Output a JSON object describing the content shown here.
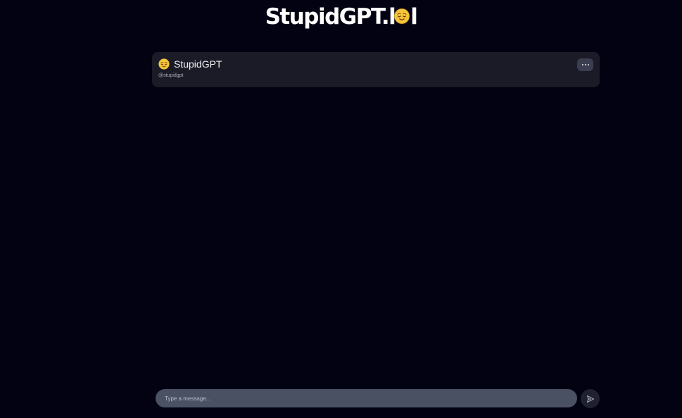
{
  "logo": {
    "text_main": "StupidGPT.l",
    "emoji_icon": "relieved-face-icon",
    "text_tail": "l",
    "full_text": "StupidGPT.lol"
  },
  "chat_header": {
    "avatar_icon": "relieved-face-icon",
    "bot_name": "StupidGPT",
    "bot_handle": "@stupidgpt",
    "menu_icon": "more-horizontal-icon"
  },
  "composer": {
    "placeholder": "Type a message...",
    "value": "",
    "send_icon": "send-icon"
  },
  "colors": {
    "background": "#020212",
    "header_card": "#1a1b27",
    "input_bg": "#4a5163",
    "emoji_yellow": "#f5c43b"
  }
}
